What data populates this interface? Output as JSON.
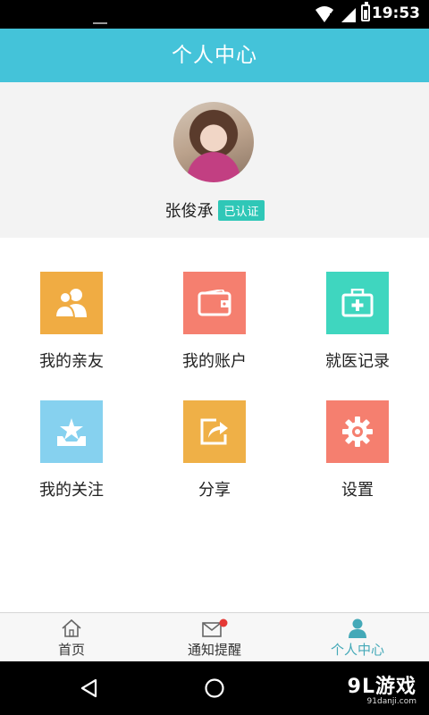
{
  "status_bar": {
    "time": "19:53"
  },
  "header": {
    "title": "个人中心"
  },
  "profile": {
    "name": "张俊承",
    "verified_badge": "已认证"
  },
  "menu": [
    {
      "label": "我的亲友",
      "icon": "friends-icon",
      "color": "#f0ac43"
    },
    {
      "label": "我的账户",
      "icon": "wallet-icon",
      "color": "#f57f6f"
    },
    {
      "label": "就医记录",
      "icon": "medical-kit-icon",
      "color": "#3fd6bf"
    },
    {
      "label": "我的关注",
      "icon": "star-tray-icon",
      "color": "#86d1ef"
    },
    {
      "label": "分享",
      "icon": "share-icon",
      "color": "#efb047"
    },
    {
      "label": "设置",
      "icon": "gear-icon",
      "color": "#f57f6f"
    }
  ],
  "tabs": [
    {
      "label": "首页",
      "icon": "home-icon"
    },
    {
      "label": "通知提醒",
      "icon": "mail-icon",
      "badge_color": "#e53935"
    },
    {
      "label": "个人中心",
      "icon": "person-icon",
      "active": true,
      "active_color": "#44a9b8"
    }
  ],
  "watermark": {
    "main": "9L游戏",
    "sub": "91danji.com"
  }
}
